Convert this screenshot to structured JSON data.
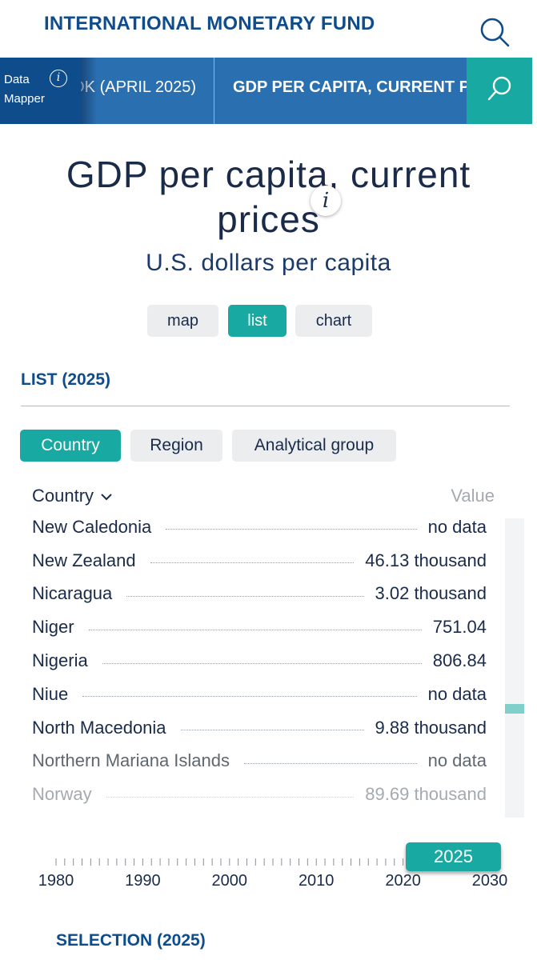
{
  "header": {
    "brand": "INTERNATIONAL MONETARY FUND",
    "search_icon": "search-icon"
  },
  "nav": {
    "data_mapper_line1": "Data",
    "data_mapper_line2": "Mapper",
    "info_glyph": "i",
    "tab_dataset": "OK (APRIL 2025)",
    "tab_indicator": "GDP PER CAPITA, CURRENT PRICES",
    "search_icon": "search-icon"
  },
  "indicator": {
    "title_line1": "GDP per capita, current",
    "title_line2": "prices",
    "info_glyph": "i",
    "unit": "U.S. dollars per capita"
  },
  "views": [
    {
      "label": "map",
      "active": false
    },
    {
      "label": "list",
      "active": true
    },
    {
      "label": "chart",
      "active": false
    }
  ],
  "list": {
    "heading": "LIST (2025)",
    "groups": [
      {
        "label": "Country",
        "active": true
      },
      {
        "label": "Region",
        "active": false
      },
      {
        "label": "Analytical group",
        "active": false
      }
    ],
    "col_country": "Country",
    "col_value": "Value",
    "rows": [
      {
        "name": "New Caledonia",
        "value": "no data"
      },
      {
        "name": "New Zealand",
        "value": "46.13 thousand"
      },
      {
        "name": "Nicaragua",
        "value": "3.02 thousand"
      },
      {
        "name": "Niger",
        "value": "751.04"
      },
      {
        "name": "Nigeria",
        "value": "806.84"
      },
      {
        "name": "Niue",
        "value": "no data"
      },
      {
        "name": "North Macedonia",
        "value": "9.88 thousand"
      },
      {
        "name": "Northern Mariana Islands",
        "value": "no data"
      },
      {
        "name": "Norway",
        "value": "89.69 thousand"
      }
    ],
    "scroll_position": 0.64
  },
  "timeline": {
    "labels": [
      "1980",
      "1990",
      "2000",
      "2010",
      "2020",
      "2030"
    ],
    "selected_year": "2025",
    "range": [
      1980,
      2030
    ]
  },
  "selection": {
    "heading": "SELECTION (2025)"
  },
  "colors": {
    "brand_blue": "#0f4c8c",
    "nav_blue": "#2a6fb0",
    "teal": "#17a9a2",
    "text_dark": "#1a2b4a",
    "button_gray": "#ebedef"
  }
}
